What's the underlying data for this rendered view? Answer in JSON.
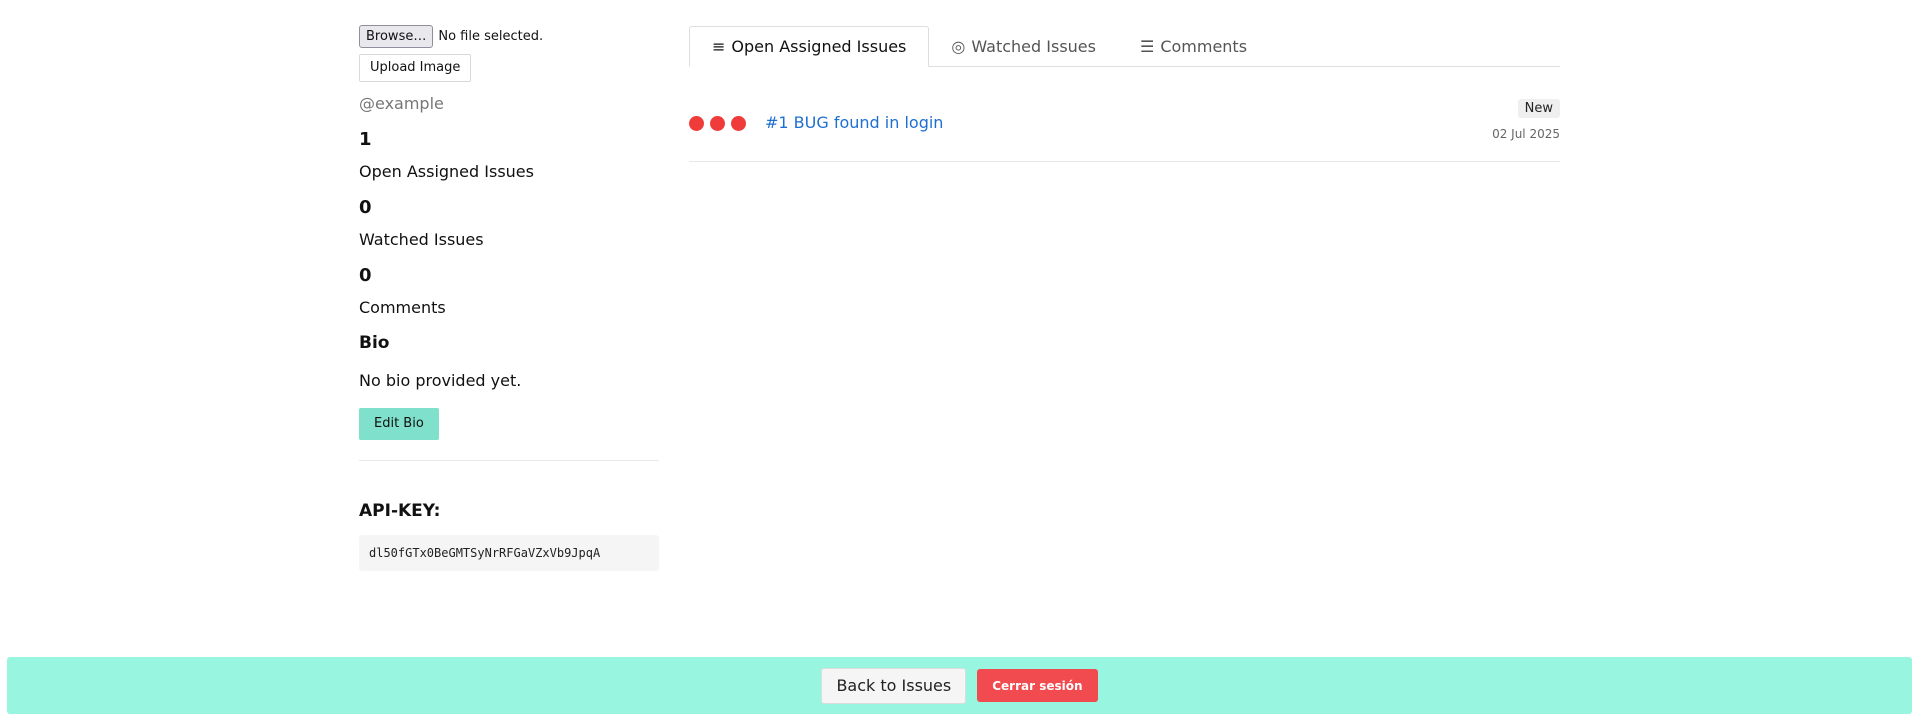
{
  "upload": {
    "browse_label": "Browse…",
    "file_status": "No file selected.",
    "upload_label": "Upload Image"
  },
  "profile": {
    "username": "@example",
    "stats": [
      {
        "value": "1",
        "label": "Open Assigned Issues"
      },
      {
        "value": "0",
        "label": "Watched Issues"
      },
      {
        "value": "0",
        "label": "Comments"
      }
    ],
    "bio_heading": "Bio",
    "bio_text": "No bio provided yet.",
    "edit_bio_label": "Edit Bio",
    "api_key_heading": "API-KEY:",
    "api_key_value": "dl50fGTx0BeGMTSyNrRFGaVZxVb9JpqA"
  },
  "tabs": [
    {
      "icon": "≡",
      "icon_name": "list-icon",
      "label": "Open Assigned Issues",
      "active": true
    },
    {
      "icon": "◎",
      "icon_name": "eye-icon",
      "label": "Watched Issues",
      "active": false
    },
    {
      "icon": "☰",
      "icon_name": "comments-icon",
      "label": "Comments",
      "active": false
    }
  ],
  "issues": [
    {
      "title": "#1 BUG found in login",
      "status": "New",
      "date": "02 Jul 2025",
      "priority_dots": 3,
      "priority_color": "#f03b3b"
    }
  ],
  "footer": {
    "back_label": "Back to Issues",
    "logout_label": "Cerrar sesión"
  },
  "colors": {
    "accent": "#7fe0cb",
    "footer_bg": "#98f5e0",
    "danger": "#f14b50",
    "link": "#1f6fd1"
  }
}
